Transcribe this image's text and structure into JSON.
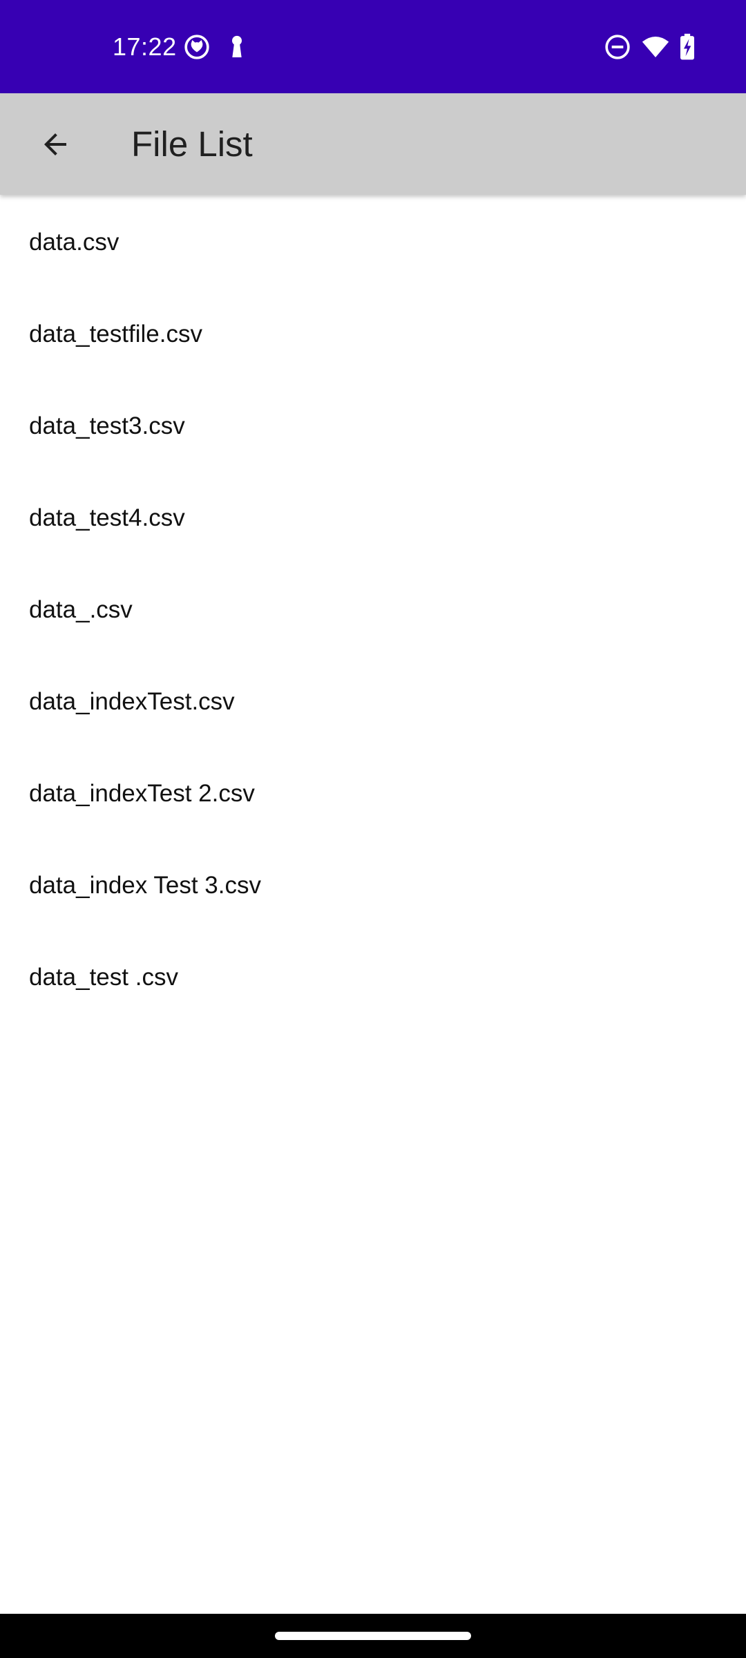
{
  "status_bar": {
    "time": "17:22",
    "icons": [
      "cat-face-icon",
      "keyhole-icon",
      "do-not-disturb-icon",
      "wifi-icon",
      "battery-charging-icon"
    ],
    "background_color": "#3700b3"
  },
  "app_bar": {
    "title": "File List",
    "back_icon": "arrow-back-icon",
    "background_color": "#cccccc"
  },
  "files": [
    "data.csv",
    "data_testfile.csv",
    "data_test3.csv",
    "data_test4.csv",
    "data_.csv",
    "data_indexTest.csv",
    "data_indexTest 2.csv",
    "data_index Test 3.csv",
    "data_test .csv"
  ]
}
